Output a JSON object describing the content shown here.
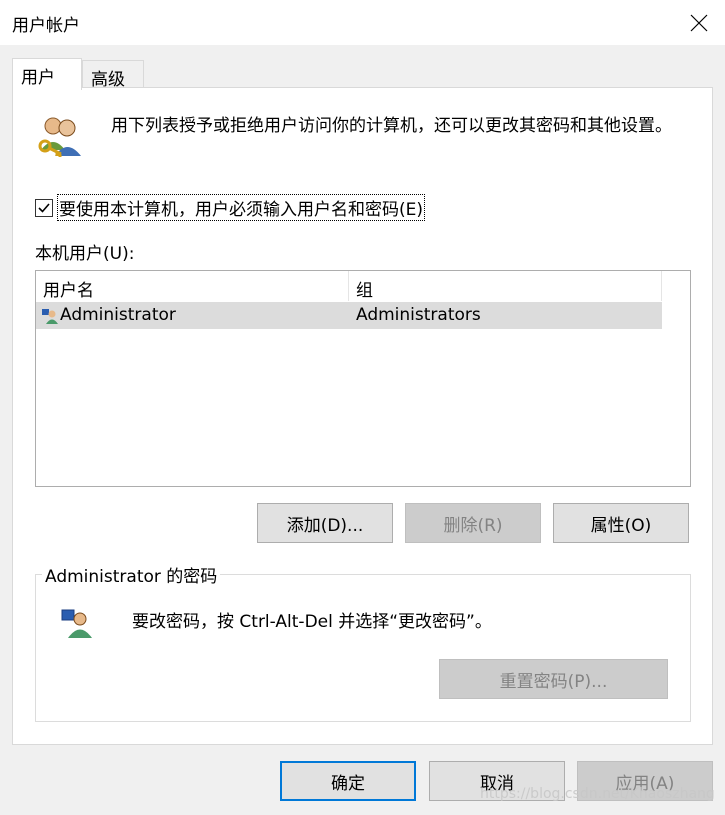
{
  "window": {
    "title": "用户帐户"
  },
  "tabs": [
    {
      "label": "用户",
      "active": true
    },
    {
      "label": "高级",
      "active": false
    }
  ],
  "intro_text": "用下列表授予或拒绝用户访问你的计算机，还可以更改其密码和其他设置。",
  "require_login_checkbox": {
    "label": "要使用本计算机，用户必须输入用户名和密码(E)",
    "checked": true
  },
  "local_users_label": "本机用户(U):",
  "users_table": {
    "columns": [
      "用户名",
      "组"
    ],
    "rows": [
      {
        "name": "Administrator",
        "group": "Administrators",
        "selected": true
      }
    ]
  },
  "list_buttons": {
    "add": "添加(D)...",
    "remove": "删除(R)",
    "properties": "属性(O)"
  },
  "password_group": {
    "legend": "Administrator 的密码",
    "message": "要改密码，按 Ctrl-Alt-Del 并选择“更改密码”。",
    "reset_button": "重置密码(P)..."
  },
  "dialog_buttons": {
    "ok": "确定",
    "cancel": "取消",
    "apply": "应用(A)"
  },
  "watermark": "https://blog.csdn.net/Khaoszhang",
  "colors": {
    "focus_border": "#0078d7",
    "selected_row": "#dcdcdc",
    "disabled_text": "#838383"
  }
}
